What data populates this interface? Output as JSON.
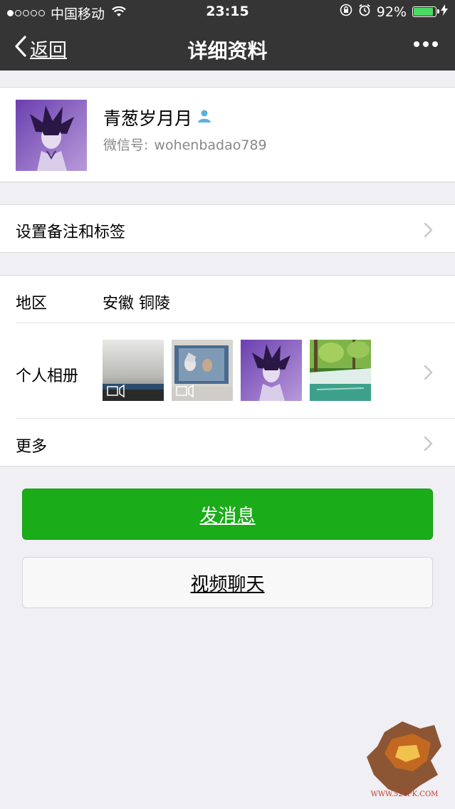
{
  "status_bar": {
    "carrier": "中国移动",
    "time": "23:15",
    "battery_pct": "92%",
    "battery_level": 0.92,
    "signal_bars_filled": 1,
    "signal_bars_total": 5
  },
  "nav": {
    "back_label": "返回",
    "title": "详细资料"
  },
  "profile": {
    "name": "青葱岁月月",
    "wechat_id_label": "微信号:",
    "wechat_id": "wohenbadao789"
  },
  "remark": {
    "label": "设置备注和标签"
  },
  "region": {
    "label": "地区",
    "value": "安徽 铜陵"
  },
  "album": {
    "label": "个人相册",
    "thumbnails": [
      {
        "kind": "video",
        "icon": "video-camera-icon"
      },
      {
        "kind": "video",
        "icon": "video-camera-icon"
      },
      {
        "kind": "photo"
      },
      {
        "kind": "photo"
      }
    ]
  },
  "more": {
    "label": "更多"
  },
  "buttons": {
    "send_message": "发消息",
    "video_chat": "视频聊天"
  },
  "watermark": {
    "url_text": "WWW.527PK.COM"
  },
  "colors": {
    "nav_bg": "#353535",
    "accent_green": "#1aad19",
    "page_bg": "#efeff4",
    "battery_green": "#4cd964"
  }
}
